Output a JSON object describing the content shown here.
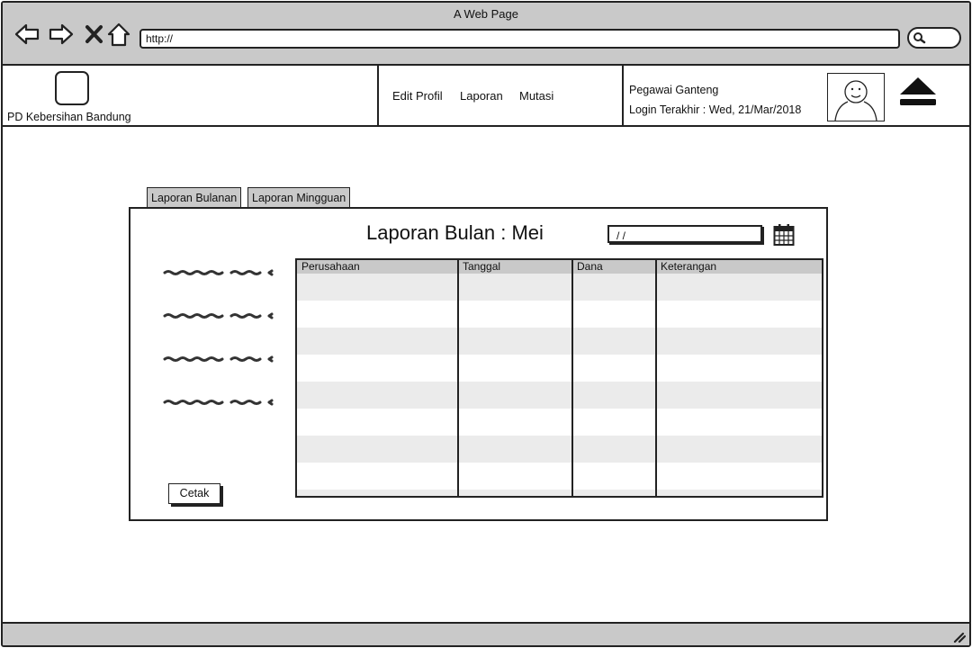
{
  "window": {
    "title": "A Web Page",
    "url": "http://"
  },
  "header": {
    "company": "PD Kebersihan Bandung",
    "menu": [
      "Edit Profil",
      "Laporan",
      "Mutasi"
    ],
    "user_name": "Pegawai Ganteng",
    "last_login": "Login Terakhir : Wed, 21/Mar/2018"
  },
  "tabs": [
    "Laporan Bulanan",
    "Laporan Mingguan"
  ],
  "report": {
    "title": "Laporan Bulan : Mei",
    "date_value": "/ /",
    "columns": [
      "Perusahaan",
      "Tanggal",
      "Dana",
      "Keterangan"
    ],
    "print_label": "Cetak"
  },
  "icons": {
    "back": "arrow-left-icon",
    "forward": "arrow-right-icon",
    "stop": "close-icon",
    "home": "home-icon",
    "search": "search-icon",
    "avatar": "user-avatar-icon",
    "logout": "eject-icon",
    "calendar": "calendar-icon"
  }
}
